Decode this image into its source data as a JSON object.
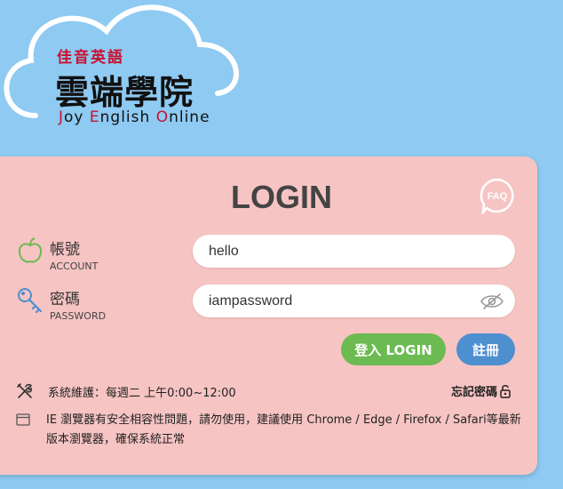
{
  "brand": {
    "subtitle": "佳音英語",
    "name": "雲端學院",
    "english_parts": [
      "J",
      "oy ",
      "E",
      "nglish ",
      "O",
      "nline"
    ]
  },
  "login": {
    "title": "LOGIN",
    "faq_label": "FAQ",
    "account": {
      "label": "帳號",
      "sublabel": "ACCOUNT",
      "value": "hello"
    },
    "password": {
      "label": "密碼",
      "sublabel": "PASSWORD",
      "value": "iampassword"
    },
    "login_button": "登入 LOGIN",
    "register_button": "註冊",
    "maintenance": "系統維護：每週二 上午0:00~12:00",
    "forgot_password": "忘記密碼",
    "notice": "IE 瀏覽器有安全相容性問題，請勿使用，建議使用 Chrome / Edge / Firefox / Safari等最新版本瀏覽器，確保系統正常"
  },
  "colors": {
    "background": "#8ecaf2",
    "card": "#f6c4c3",
    "brand_red": "#c8102e",
    "login_green": "#6cba52",
    "register_blue": "#4e8fd0"
  },
  "icons": {
    "account": "apple-icon",
    "password": "key-icon",
    "faq": "faq-bubble-icon",
    "eye": "eye-slash-icon",
    "maintenance": "tools-icon",
    "forgot": "lock-icon",
    "notice": "browser-window-icon"
  }
}
